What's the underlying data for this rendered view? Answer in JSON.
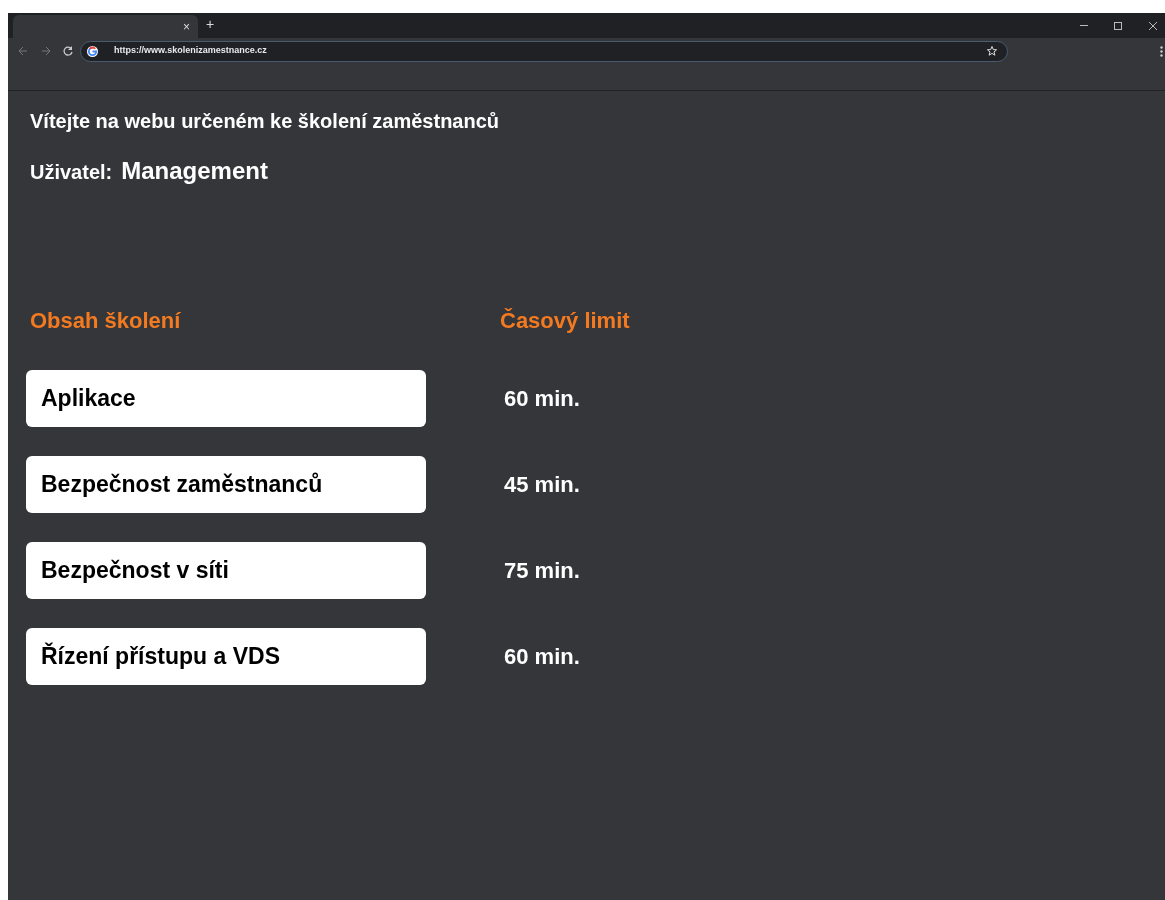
{
  "browser": {
    "tab_close": "×",
    "new_tab": "+",
    "url": "https://www.skolenizamestnance.cz"
  },
  "page": {
    "welcome": "Vítejte na webu určeném ke školení zaměstnanců",
    "user_label": "Uživatel:",
    "user_name": "Management",
    "columns": [
      "Obsah školení",
      "Časový limit"
    ],
    "rows": [
      {
        "course": "Aplikace",
        "limit": "60 min."
      },
      {
        "course": "Bezpečnost zaměstnanců",
        "limit": "45 min."
      },
      {
        "course": "Bezpečnost v síti",
        "limit": "75 min."
      },
      {
        "course": "Řízení přístupu a VDS",
        "limit": "60 min."
      }
    ]
  }
}
